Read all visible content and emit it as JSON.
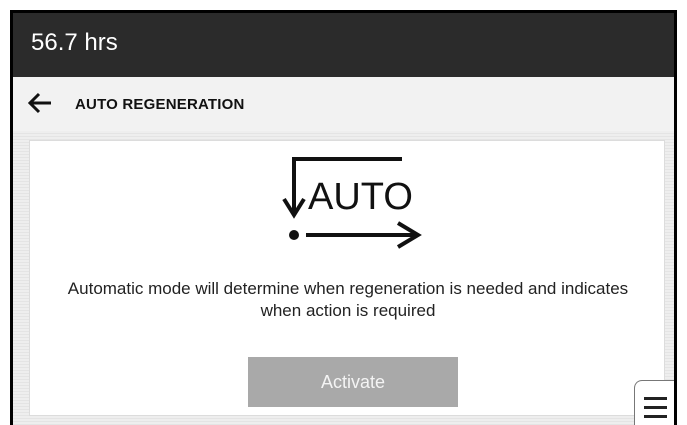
{
  "status": {
    "hours": "56.7 hrs"
  },
  "nav": {
    "title": "AUTO REGENERATION",
    "back_icon": "arrow-left-icon"
  },
  "main": {
    "graphic_label": "AUTO",
    "description": "Automatic mode will determine when regeneration is needed and indicates when action is required",
    "activate_label": "Activate"
  },
  "menu": {
    "icon": "hamburger-menu-icon"
  },
  "colors": {
    "status_bar_bg": "#2b2b2b",
    "activate_bg": "#a9a9a9",
    "text": "#222222"
  }
}
